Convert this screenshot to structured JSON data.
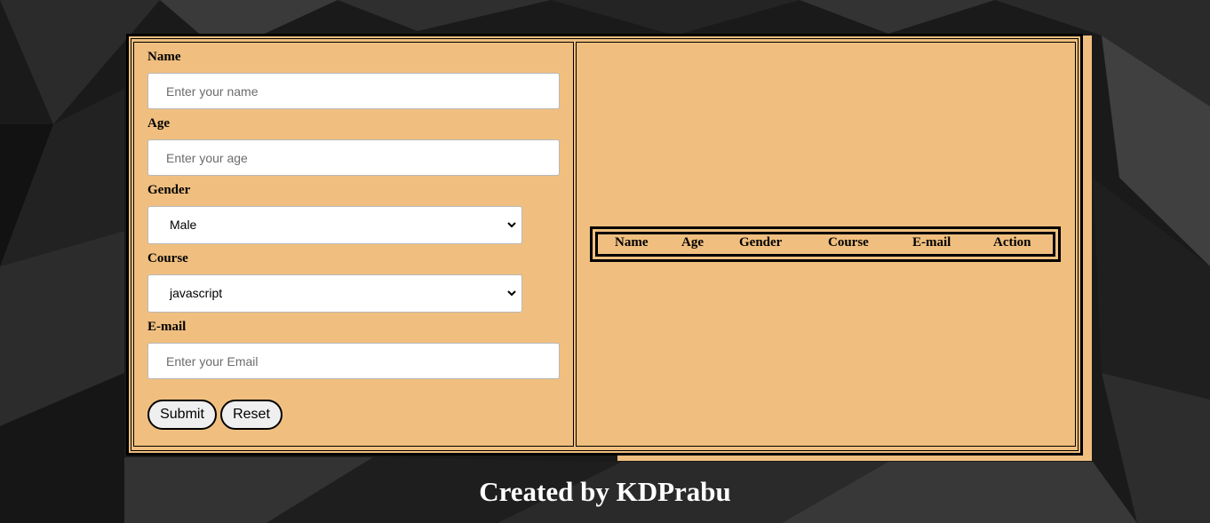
{
  "form": {
    "name": {
      "label": "Name",
      "placeholder": "Enter your name",
      "value": ""
    },
    "age": {
      "label": "Age",
      "placeholder": "Enter your age",
      "value": ""
    },
    "gender": {
      "label": "Gender",
      "selected": "Male"
    },
    "course": {
      "label": "Course",
      "selected": "javascript"
    },
    "email": {
      "label": "E-mail",
      "placeholder": "Enter your Email",
      "value": ""
    },
    "submit_label": "Submit",
    "reset_label": "Reset"
  },
  "records_table": {
    "headers": [
      "Name",
      "Age",
      "Gender",
      "Course",
      "E-mail",
      "Action"
    ]
  },
  "footer": {
    "credit": "Created by KDPrabu"
  },
  "colors": {
    "panel": "#f0bf7f",
    "border": "#000000",
    "background": "#1b1b1b",
    "footer_text": "#ffffff"
  },
  "icons": {
    "select_arrow": "chevron-down-icon"
  }
}
